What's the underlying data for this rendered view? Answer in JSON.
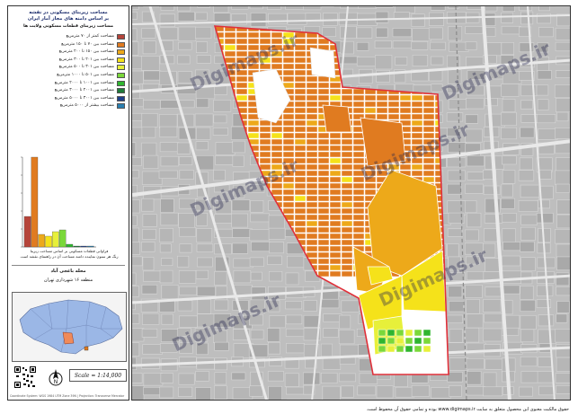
{
  "map": {
    "title_line1": "مساحت زیربنای مسکونی در نقشه",
    "title_line2": "بر اساس دامنه های مجاز آمار ایران",
    "legend_title": "مساحت زیربنای قطعات مسکونی ولایت ها",
    "legend": [
      {
        "label": "مساحت کمتر از ۷۰ مترمربع",
        "color": "#b5443a"
      },
      {
        "label": "مساحت بین ۷۰ تا ۱۵۰ مترمربع",
        "color": "#e07b20"
      },
      {
        "label": "مساحت بین ۱۵۰ تا ۲۰۰ مترمربع",
        "color": "#eda91a"
      },
      {
        "label": "مساحت بین ۲۰۱ تا ۳۰۰ مترمربع",
        "color": "#f5e21a"
      },
      {
        "label": "مساحت بین ۳۰۱ تا ۵۰۰ مترمربع",
        "color": "#e7f03a"
      },
      {
        "label": "مساحت بین ۵۰۱ تا ۱۰۰۰ مترمربع",
        "color": "#7ad83a"
      },
      {
        "label": "مساحت بین ۱۰۰۱ تا ۲۰۰۰ مترمربع",
        "color": "#2fb52f"
      },
      {
        "label": "مساحت بین ۲۰۰۱ تا ۳۰۰۰ مترمربع",
        "color": "#1f7a3a"
      },
      {
        "label": "مساحت بین ۳۰۰۱ تا ۵۰۰۰ مترمربع",
        "color": "#1f3f8a"
      },
      {
        "label": "مساحت بیشتر از ۵۰۰۰ مترمربع",
        "color": "#2a7fb0"
      }
    ],
    "histogram": {
      "values": [
        34,
        100,
        14,
        12,
        17,
        19,
        3,
        1,
        1,
        1
      ],
      "caption_line1": "فراوانی قطعات مسکونی بر اساس مساحت زیربنا",
      "caption_line2": "رنگ هر ستون نماینده دامنه مساحت آن در راهنمای نقشه است"
    },
    "area_title": "محله باغجی آباد",
    "district_line": "منطقه ۱۶ شهرداری تهران",
    "scale": "Scale = 1:14,000",
    "north": "N",
    "footer": "Coordinate System: WGS 1984 UTM Zone 39N  |  Projection: Transverse Mercator",
    "watermark": "Digimaps.ir",
    "copyright": "حقوق مالکیت معنوی این محصول متعلق به سایت www.digimaps.ir بوده و تمامی حقوق آن محفوظ است."
  }
}
